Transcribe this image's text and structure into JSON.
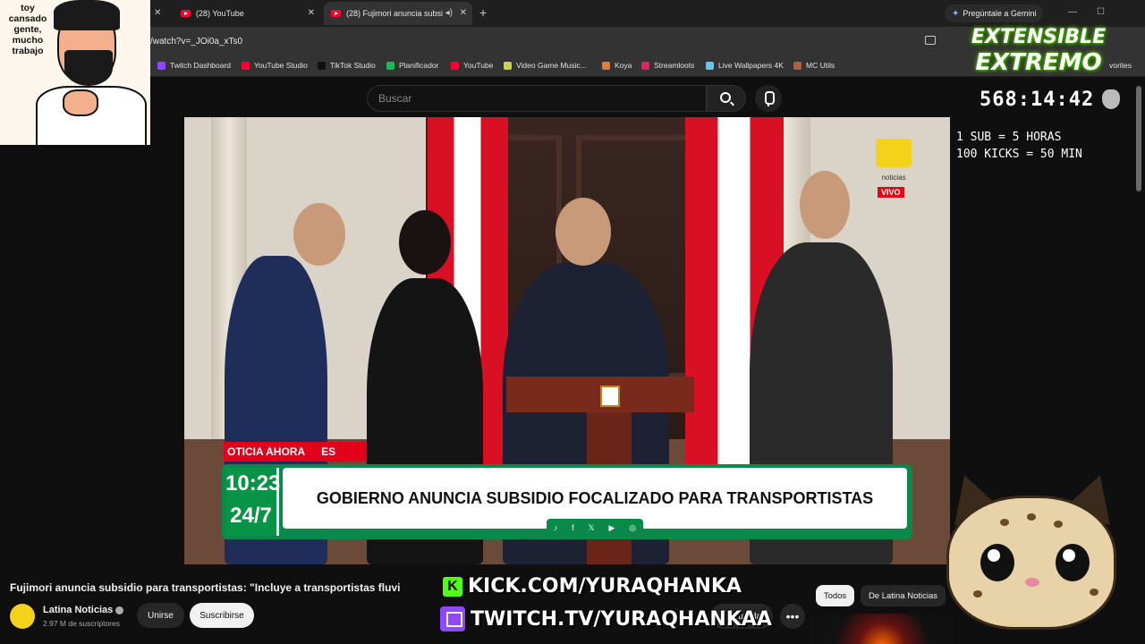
{
  "browser": {
    "tabs": [
      {
        "label": "(28) YouTube"
      },
      {
        "label": "(28) Fujimori anuncia subsi"
      }
    ],
    "gemini_label": "Pregúntale a Gemini",
    "url": "/watch?v=_JOi0a_xTs0",
    "bookmarks": [
      {
        "label": "Twitch Dashboard",
        "color": "#9146ff"
      },
      {
        "label": "YouTube Studio",
        "color": "#ff0033"
      },
      {
        "label": "TikTok Studio",
        "color": "#111111"
      },
      {
        "label": "Planificador",
        "color": "#1db954"
      },
      {
        "label": "YouTube",
        "color": "#ff0033"
      },
      {
        "label": "Video Game Music...",
        "color": "#c9d84a"
      },
      {
        "label": "Koya",
        "color": "#e07b39"
      },
      {
        "label": "Streamloots",
        "color": "#e0245e"
      },
      {
        "label": "Live Wallpapers 4K",
        "color": "#5ec8f0"
      },
      {
        "label": "MC Utils",
        "color": "#b06040"
      }
    ],
    "favorites_fragment": "vorites"
  },
  "youtube": {
    "search_placeholder": "Buscar",
    "video": {
      "channel_logo_text": "noticias",
      "live_label": "VIVO",
      "ticker_text": "OTICIA AHORA",
      "ticker_suffix": "ES",
      "clock_time": "10:23",
      "clock_247": "24/7",
      "headline": "GOBIERNO ANUNCIA SUBSIDIO FOCALIZADO PARA TRANSPORTISTAS"
    },
    "title": "Fujimori anuncia subsidio para transportistas: \"Incluye a transportistas fluvi",
    "channel": {
      "name": "Latina Noticias",
      "subscribers": "2.97 M de suscriptores"
    },
    "buttons": {
      "join": "Unirse",
      "subscribe": "Suscribirse",
      "save": "Guardar",
      "more": "•••"
    },
    "chips": {
      "all": "Todos",
      "channel": "De Latina Noticias"
    }
  },
  "overlay": {
    "streamer_caption": "toy cansado gente, mucho trabajo",
    "event_title_1": "EXTENSIBLE",
    "event_title_2": "EXTREMO",
    "timer": "568:14:42",
    "rule_1": "1 SUB = 5 HORAS",
    "rule_2": "100 KICKS = 50 MIN",
    "kick_url": "KICK.COM/YURAQHANKA",
    "twitch_url": "TWITCH.TV/YURAQHANKAA",
    "kick_color": "#53fc18",
    "twitch_color": "#9146ff"
  }
}
